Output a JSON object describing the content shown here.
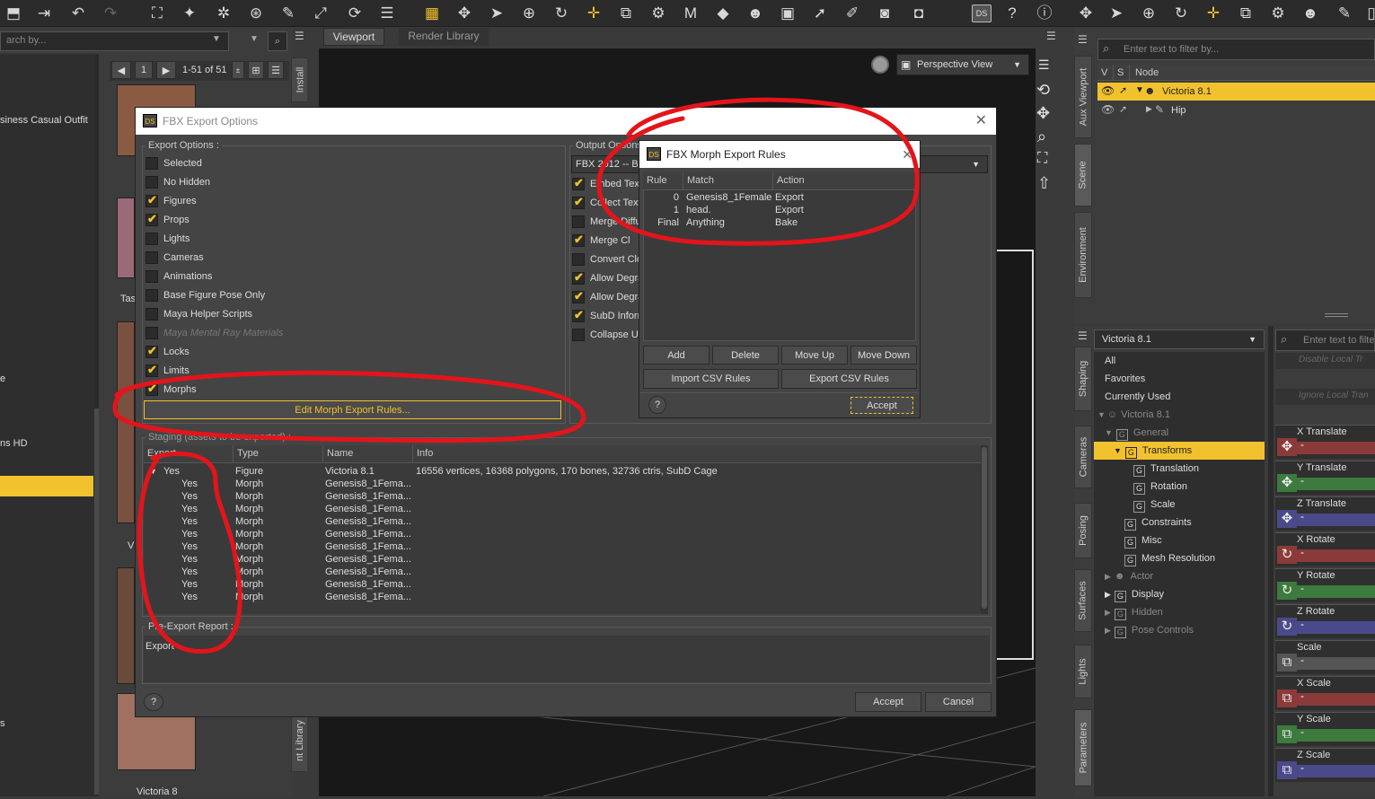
{
  "toolbar": {
    "left_search_placeholder": "arch by...",
    "right_filter_placeholder": "Enter text to filter by..."
  },
  "content_library": {
    "page_number": "1",
    "page_range": "1-51 of 51",
    "items": [
      "siness Casual Outfit",
      "Tas",
      "e",
      "ns HD",
      "V",
      "s",
      "Victoria 8"
    ],
    "vertical_labels": [
      "Install",
      "nt Library"
    ]
  },
  "viewport": {
    "tabs": [
      "Viewport",
      "Render Library"
    ],
    "view_select": "Perspective View"
  },
  "scene": {
    "columns": [
      "V",
      "S",
      "Node"
    ],
    "nodes": [
      {
        "label": "Victoria 8.1",
        "selected": true
      },
      {
        "label": "Hip",
        "selected": false
      }
    ],
    "vertical_tabs": [
      "Aux Viewport",
      "Scene",
      "Environment"
    ]
  },
  "parameters": {
    "vertical_tabs": [
      "Shaping",
      "Cameras",
      "Posing",
      "Surfaces",
      "Lights",
      "Parameters"
    ],
    "figure_select": "Victoria 8.1",
    "filter_placeholder": "Enter text to filter by...",
    "hidden_options": [
      "Disable Local Tr",
      "Ignore Local Tran"
    ],
    "tree": [
      {
        "label": "All"
      },
      {
        "label": "Favorites"
      },
      {
        "label": "Currently Used"
      },
      {
        "label": "Victoria 8.1"
      },
      {
        "label": "General"
      },
      {
        "label": "Transforms"
      },
      {
        "label": "Translation"
      },
      {
        "label": "Rotation"
      },
      {
        "label": "Scale"
      },
      {
        "label": "Constraints"
      },
      {
        "label": "Misc"
      },
      {
        "label": "Mesh Resolution"
      },
      {
        "label": "Actor"
      },
      {
        "label": "Display"
      },
      {
        "label": "Hidden"
      },
      {
        "label": "Pose Controls"
      }
    ],
    "sliders": [
      {
        "label": "X Translate",
        "color": "#8b3a3a"
      },
      {
        "label": "Y Translate",
        "color": "#3d7a3d"
      },
      {
        "label": "Z Translate",
        "color": "#4a4a8a"
      },
      {
        "label": "X Rotate",
        "color": "#8b3a3a"
      },
      {
        "label": "Y Rotate",
        "color": "#3d7a3d"
      },
      {
        "label": "Z Rotate",
        "color": "#4a4a8a"
      },
      {
        "label": "Scale",
        "color": "#555555"
      },
      {
        "label": "X Scale",
        "color": "#8b3a3a"
      },
      {
        "label": "Y Scale",
        "color": "#3d7a3d"
      },
      {
        "label": "Z Scale",
        "color": "#4a4a8a"
      }
    ]
  },
  "fbx_dialog": {
    "title": "FBX Export Options",
    "export_options_label": "Export Options :",
    "export_options": [
      {
        "label": "Selected",
        "checked": false,
        "disabled": false
      },
      {
        "label": "No Hidden",
        "checked": false,
        "disabled": false
      },
      {
        "label": "Figures",
        "checked": true,
        "disabled": false
      },
      {
        "label": "Props",
        "checked": true,
        "disabled": false
      },
      {
        "label": "Lights",
        "checked": false,
        "disabled": false
      },
      {
        "label": "Cameras",
        "checked": false,
        "disabled": false
      },
      {
        "label": "Animations",
        "checked": false,
        "disabled": false
      },
      {
        "label": "Base Figure Pose Only",
        "checked": false,
        "disabled": false
      },
      {
        "label": "Maya Helper Scripts",
        "checked": false,
        "disabled": false
      },
      {
        "label": "Maya Mental Ray Materials",
        "checked": false,
        "disabled": true
      },
      {
        "label": "Locks",
        "checked": true,
        "disabled": false
      },
      {
        "label": "Limits",
        "checked": true,
        "disabled": false
      },
      {
        "label": "Morphs",
        "checked": true,
        "disabled": false
      }
    ],
    "edit_morph_button": "Edit Morph Export Rules...",
    "output_options_label": "Output Options",
    "output_format": "FBX 2012 -- Bi",
    "output_options": [
      {
        "label": "Embed Text",
        "checked": true
      },
      {
        "label": "Collect Text",
        "checked": true
      },
      {
        "label": "Merge Diffu",
        "checked": false
      },
      {
        "label": "Merge Cl",
        "checked": true
      },
      {
        "label": "Convert Clo",
        "checked": false
      },
      {
        "label": "Allow Degra",
        "checked": true
      },
      {
        "label": "Allow Degra",
        "checked": true
      },
      {
        "label": "SubD Inform",
        "checked": true
      },
      {
        "label": "Collapse UV",
        "checked": false
      }
    ],
    "staging_label": "Staging (assets to be exported) :",
    "staging_columns": [
      "Export",
      "Type",
      "Name",
      "Info"
    ],
    "staging_rows": [
      {
        "export": "Yes",
        "type": "Figure",
        "name": "Victoria 8.1",
        "info": "16556 vertices, 16368 polygons, 170 bones, 32736 ctris, SubD Cage"
      },
      {
        "export": "Yes",
        "type": "Morph",
        "name": "Genesis8_1Fema...",
        "info": ""
      },
      {
        "export": "Yes",
        "type": "Morph",
        "name": "Genesis8_1Fema...",
        "info": ""
      },
      {
        "export": "Yes",
        "type": "Morph",
        "name": "Genesis8_1Fema...",
        "info": ""
      },
      {
        "export": "Yes",
        "type": "Morph",
        "name": "Genesis8_1Fema...",
        "info": ""
      },
      {
        "export": "Yes",
        "type": "Morph",
        "name": "Genesis8_1Fema...",
        "info": ""
      },
      {
        "export": "Yes",
        "type": "Morph",
        "name": "Genesis8_1Fema...",
        "info": ""
      },
      {
        "export": "Yes",
        "type": "Morph",
        "name": "Genesis8_1Fema...",
        "info": ""
      },
      {
        "export": "Yes",
        "type": "Morph",
        "name": "Genesis8_1Fema...",
        "info": ""
      },
      {
        "export": "Yes",
        "type": "Morph",
        "name": "Genesis8_1Fema...",
        "info": ""
      },
      {
        "export": "Yes",
        "type": "Morph",
        "name": "Genesis8_1Fema...",
        "info": ""
      }
    ],
    "report_label": "Pre-Export Report :",
    "report_text": "Export",
    "help": "?",
    "accept": "Accept",
    "cancel": "Cancel"
  },
  "morph_dialog": {
    "title": "FBX Morph Export Rules",
    "columns": [
      "Rule",
      "Match",
      "Action"
    ],
    "rules": [
      {
        "rule": "0",
        "match": "Genesis8_1Female.",
        "action": "Export"
      },
      {
        "rule": "1",
        "match": "head.",
        "action": "Export"
      },
      {
        "rule": "Final",
        "match": "Anything",
        "action": "Bake"
      }
    ],
    "buttons": [
      "Add",
      "Delete",
      "Move Up",
      "Move Down"
    ],
    "import_csv": "Import CSV Rules",
    "export_csv": "Export CSV Rules",
    "help": "?",
    "accept": "Accept"
  }
}
